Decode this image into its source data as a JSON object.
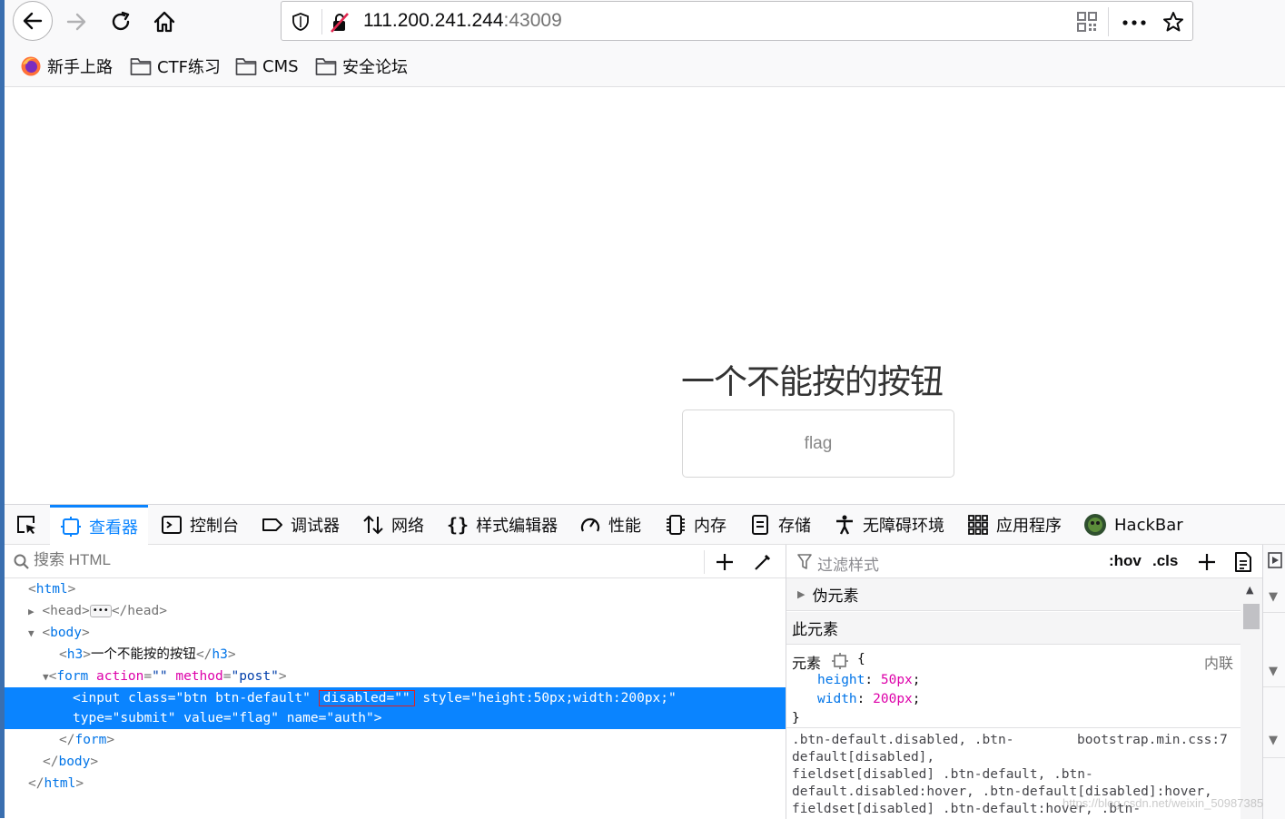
{
  "browser": {
    "url_host": "111.200.241.244",
    "url_port": ":43009"
  },
  "bookmarks": [
    {
      "label": "新手上路",
      "icon": "firefox-icon"
    },
    {
      "label": "CTF练习",
      "icon": "folder-icon"
    },
    {
      "label": "CMS",
      "icon": "folder-icon"
    },
    {
      "label": "安全论坛",
      "icon": "folder-icon"
    }
  ],
  "page": {
    "heading": "一个不能按的按钮",
    "button_label": "flag"
  },
  "devtools": {
    "tabs": [
      {
        "label": "查看器",
        "icon": "inspector-icon",
        "active": true
      },
      {
        "label": "控制台",
        "icon": "console-icon"
      },
      {
        "label": "调试器",
        "icon": "debugger-icon"
      },
      {
        "label": "网络",
        "icon": "network-icon"
      },
      {
        "label": "样式编辑器",
        "icon": "style-editor-icon"
      },
      {
        "label": "性能",
        "icon": "performance-icon"
      },
      {
        "label": "内存",
        "icon": "memory-icon"
      },
      {
        "label": "存储",
        "icon": "storage-icon"
      },
      {
        "label": "无障碍环境",
        "icon": "accessibility-icon"
      },
      {
        "label": "应用程序",
        "icon": "application-icon"
      },
      {
        "label": "HackBar",
        "icon": "hackbar-icon"
      }
    ],
    "html_search_placeholder": "搜索 HTML",
    "markup": {
      "html_open": "html",
      "head": "head",
      "body": "body",
      "h3": "h3",
      "h3_text": "一个不能按的按钮",
      "form": "form",
      "form_action_attr": "action",
      "form_action_val": "\"\"",
      "form_method_attr": "method",
      "form_method_val": "\"post\"",
      "input_line1_a": "<input class=\"btn btn-default\" ",
      "input_disabled": "disabled=\"\"",
      "input_line1_b": " style=\"height:50px;width:200px;\"",
      "input_line2": "type=\"submit\" value=\"flag\" name=\"auth\">",
      "form_close": "form",
      "body_close": "body",
      "html_close": "html"
    },
    "rules": {
      "filter_placeholder": "过滤样式",
      "hov": ":hov",
      "cls": ".cls",
      "pseudo_section": "伪元素",
      "this_element": "此元素",
      "element_label": "元素",
      "inline_label": "内联",
      "decl1_prop": "height",
      "decl1_val": "50px",
      "decl2_prop": "width",
      "decl2_val": "200px",
      "source": "bootstrap.min.css:7",
      "selector_lines": [
        ".btn-default.disabled, .btn-",
        "default[disabled],",
        "fieldset[disabled] .btn-default, .btn-",
        "default.disabled:hover, .btn-default[disabled]:hover,",
        "fieldset[disabled] .btn-default:hover, .btn-"
      ]
    }
  },
  "watermark": "https://blog.csdn.net/weixin_50987385"
}
